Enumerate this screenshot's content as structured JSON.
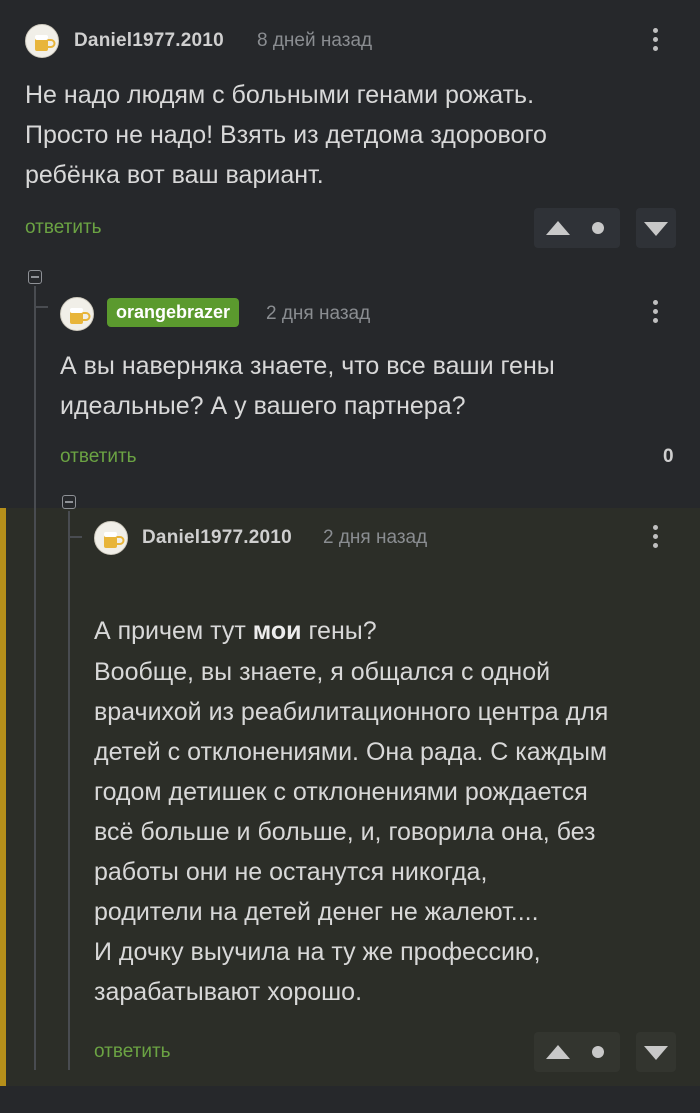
{
  "comments": [
    {
      "username": "Daniel1977.2010",
      "time": "8 дней назад",
      "text": "Не надо людям с больными генами рожать.\nПросто не надо! Взять из детдома здорового\nребёнка вот ваш вариант.",
      "reply_label": "ответить"
    },
    {
      "username": "orangebrazer",
      "time": "2 дня назад",
      "text": "А вы наверняка знаете, что все ваши гены\nидеальные? А у вашего партнера?",
      "reply_label": "ответить",
      "rating": "0"
    },
    {
      "username": "Daniel1977.2010",
      "time": "2 дня назад",
      "text_before_bold": "А причем тут ",
      "text_bold": "мои",
      "text_after_bold": " гены?",
      "text_body": "Вообще, вы знаете, я общался с одной\nврачихой из реабилитационного центра для\nдетей с отклонениями. Она рада. С каждым\nгодом детишек с отклонениями рождается\nвсё больше и больше, и, говорила она, без\nработы они не останутся никогда,\nродители на детей денег не жалеют....\nИ дочку выучила на ту же профессию,\nзарабатывают хорошо.",
      "reply_label": "ответить"
    }
  ],
  "icons": {
    "avatar": "beer-mug-avatar-icon",
    "more": "kebab-menu-icon",
    "upvote": "triangle-up-icon",
    "downvote": "triangle-down-icon",
    "collapse": "collapse-minus-icon"
  },
  "colors": {
    "background": "#26282b",
    "reply_link": "#6ba343",
    "badge": "#5b9a2e",
    "highlight_accent": "#b58f1a",
    "highlight_bg": "#2c2e28"
  }
}
